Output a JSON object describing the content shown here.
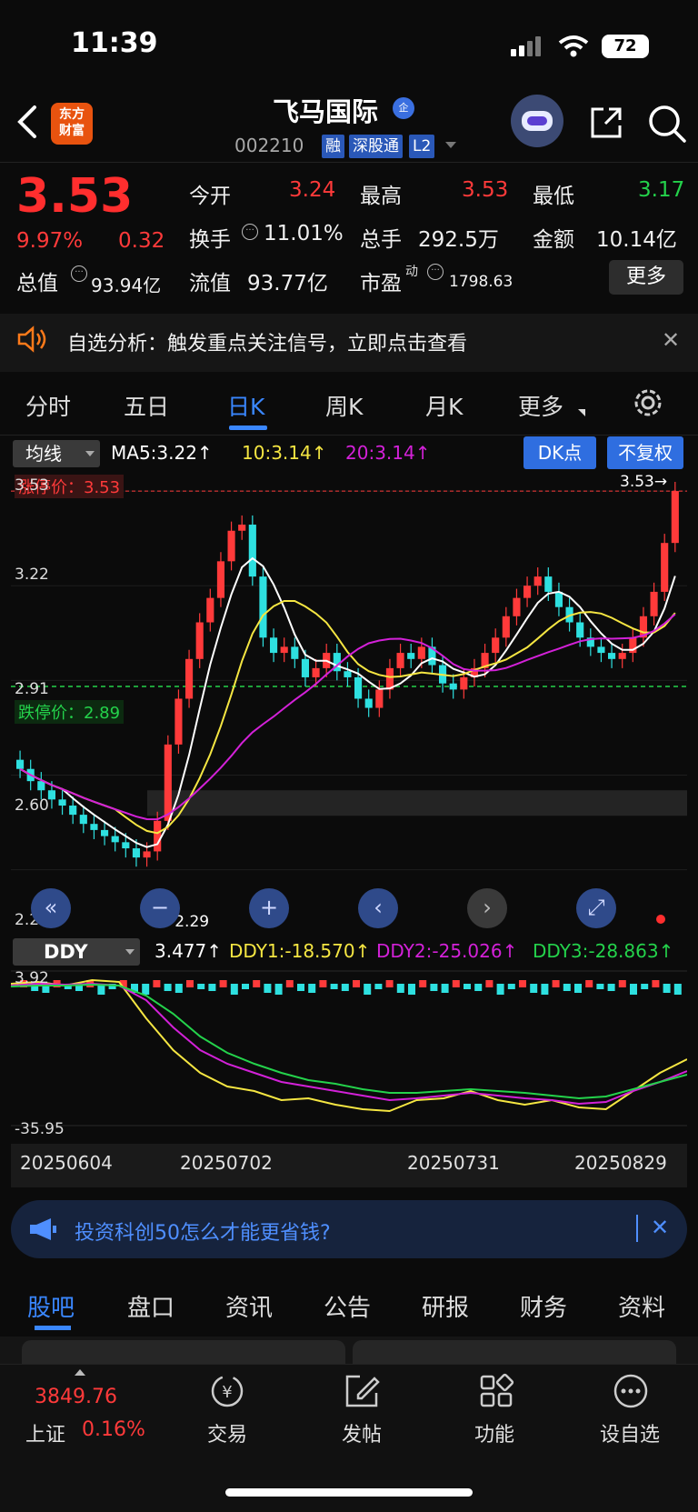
{
  "status": {
    "time": "11:39",
    "battery": "72"
  },
  "header": {
    "stock_name": "飞马国际",
    "verify_badge": "企",
    "code": "002210",
    "tags": [
      "融",
      "深股通",
      "L2"
    ],
    "logo": "东方\n财富"
  },
  "quote": {
    "price": "3.53",
    "change_pct": "9.97%",
    "change": "0.32",
    "open_label": "今开",
    "open": "3.24",
    "high_label": "最高",
    "high": "3.53",
    "low_label": "最低",
    "low": "3.17",
    "turnover_label": "换手",
    "turnover": "11.01%",
    "volume_label": "总手",
    "volume": "292.5万",
    "amount_label": "金额",
    "amount": "10.14亿",
    "mcap_label": "总值",
    "mcap": "93.94亿",
    "float_label": "流值",
    "float": "93.77亿",
    "pe_label": "市盈",
    "pe_sup": "动",
    "pe": "1798.63",
    "more_label": "更多"
  },
  "notice": {
    "text": "自选分析：触发重点关注信号，立即点击查看"
  },
  "tabs": [
    "分时",
    "五日",
    "日K",
    "周K",
    "月K",
    "更多"
  ],
  "ma_legend": {
    "select": "均线",
    "ma5": "MA5:3.22↑",
    "ma10": "10:3.14↑",
    "ma20": "20:3.14↑"
  },
  "buttons": {
    "dk": "DK点",
    "fq": "不复权"
  },
  "kline_labels": {
    "y_3_53": "3.53",
    "y_3_22": "3.22",
    "y_2_91": "2.91",
    "y_2_60": "2.60",
    "y_2_29": "2.29",
    "limit_up": "涨停价：3.53",
    "limit_down": "跌停价：2.89",
    "max_marker": "3.53→",
    "min_marker": "←2.29"
  },
  "ddy_legend": {
    "select": "DDY",
    "ddy": "3.477↑",
    "ddy1": "DDY1:-18.570↑",
    "ddy2": "DDY2:-25.026↑",
    "ddy3": "DDY3:-28.863↑",
    "y_top": "3.92",
    "y_bottom": "-35.95"
  },
  "dates": [
    "20250604",
    "20250702",
    "20250731",
    "20250829"
  ],
  "ad": {
    "text": "投资科创50怎么才能更省钱?"
  },
  "bottom_tabs": [
    "股吧",
    "盘口",
    "资讯",
    "公告",
    "研报",
    "财务",
    "资料"
  ],
  "nav": {
    "index_value": "3849.76",
    "index_name": "上证",
    "index_change": "0.16%",
    "items": [
      "交易",
      "发帖",
      "功能",
      "设自选"
    ]
  },
  "colors": {
    "up": "#ff3a3a",
    "down": "#2ee0e0",
    "ma5": "#ffffff",
    "ma10": "#f5e642",
    "ma20": "#d321d8",
    "accent": "#2f6ee0"
  }
}
